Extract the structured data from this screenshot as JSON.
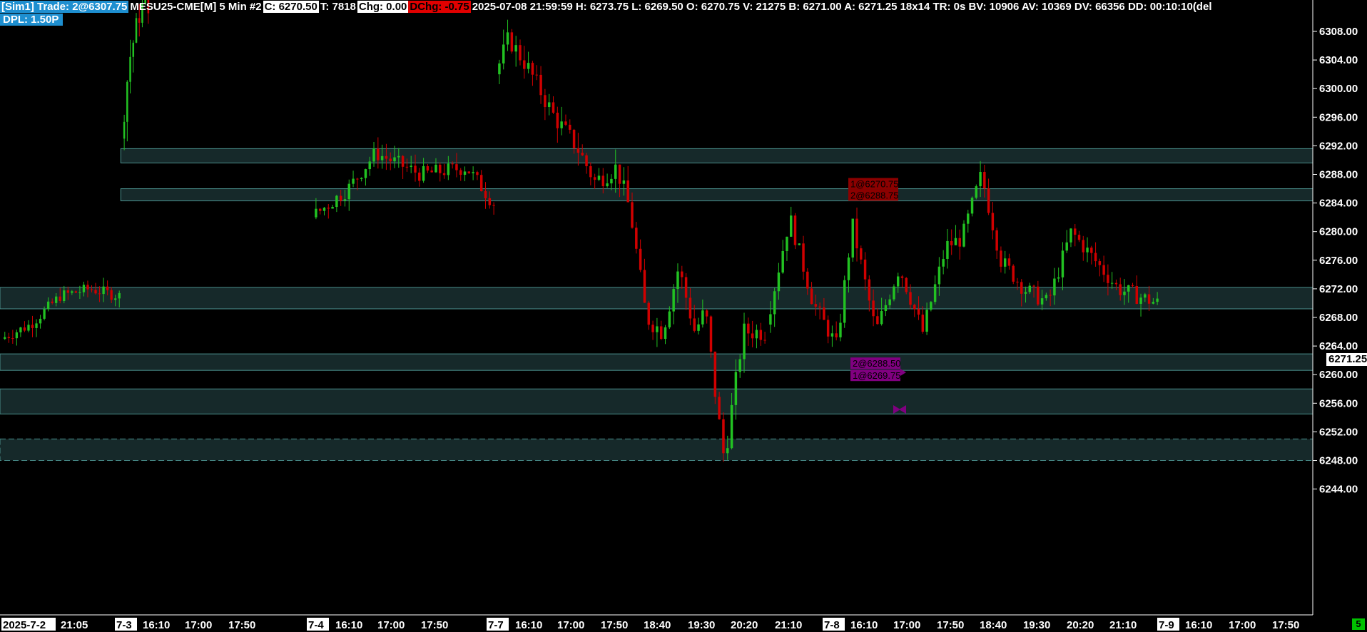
{
  "header": {
    "sim": "[Sim1]  Trade: 2@6307.75",
    "symbol": "MESU25-CME[M]  5 Min  #2",
    "close": "C: 6270.50",
    "trades": "T: 7818",
    "chg": "Chg: 0.00",
    "dchg": "DChg: -0.75",
    "info": "2025-07-08 21:59:59 H: 6273.75 L: 6269.50 O: 6270.75 V: 21275 B: 6271.00 A: 6271.25 18x14 TR: 0s BV: 10906 AV: 10369 DV: 66356 DD: 00:10:10(del",
    "dpl": "DPL: 1.50P"
  },
  "current_price_label": "6271.25",
  "corner_badge": "5",
  "colors": {
    "up": "#22c222",
    "down": "#d00000",
    "zone_fill": "#16292a",
    "zone_border": "#4a8f8c",
    "order_sell": "#8b0000",
    "order_buy": "#800080"
  },
  "chart_data": {
    "type": "candlestick",
    "timeframe": "5 Min",
    "y_ticks": [
      6308.0,
      6304.0,
      6300.0,
      6296.0,
      6292.0,
      6288.0,
      6284.0,
      6280.0,
      6276.0,
      6272.0,
      6268.0,
      6264.0,
      6260.0,
      6256.0,
      6252.0,
      6248.0,
      6244.0
    ],
    "ylim": [
      6242.0,
      6311.0
    ],
    "x_labels": [
      {
        "label": "2025-7-2",
        "boxed": true
      },
      {
        "label": "21:05",
        "boxed": false
      },
      {
        "label": "7-3",
        "boxed": true
      },
      {
        "label": "16:10",
        "boxed": false
      },
      {
        "label": "17:00",
        "boxed": false
      },
      {
        "label": "17:50",
        "boxed": false
      },
      {
        "label": "7-4",
        "boxed": true
      },
      {
        "label": "16:10",
        "boxed": false
      },
      {
        "label": "17:00",
        "boxed": false
      },
      {
        "label": "17:50",
        "boxed": false
      },
      {
        "label": "7-7",
        "boxed": true
      },
      {
        "label": "16:10",
        "boxed": false
      },
      {
        "label": "17:00",
        "boxed": false
      },
      {
        "label": "17:50",
        "boxed": false
      },
      {
        "label": "18:40",
        "boxed": false
      },
      {
        "label": "19:30",
        "boxed": false
      },
      {
        "label": "20:20",
        "boxed": false
      },
      {
        "label": "21:10",
        "boxed": false
      },
      {
        "label": "7-8",
        "boxed": true
      },
      {
        "label": "16:10",
        "boxed": false
      },
      {
        "label": "17:00",
        "boxed": false
      },
      {
        "label": "17:50",
        "boxed": false
      },
      {
        "label": "18:40",
        "boxed": false
      },
      {
        "label": "19:30",
        "boxed": false
      },
      {
        "label": "20:20",
        "boxed": false
      },
      {
        "label": "21:10",
        "boxed": false
      },
      {
        "label": "7-9",
        "boxed": true
      },
      {
        "label": "16:10",
        "boxed": false
      },
      {
        "label": "17:00",
        "boxed": false
      },
      {
        "label": "17:50",
        "boxed": false
      }
    ],
    "zones": [
      {
        "top": 6291.6,
        "bottom": 6289.6,
        "start": 0.092,
        "dashed": false
      },
      {
        "top": 6286.0,
        "bottom": 6284.3,
        "start": 0.092,
        "dashed": false
      },
      {
        "top": 6272.2,
        "bottom": 6269.2,
        "start": 0.0,
        "dashed": false
      },
      {
        "top": 6262.9,
        "bottom": 6260.6,
        "start": 0.0,
        "dashed": false
      },
      {
        "top": 6258.0,
        "bottom": 6254.5,
        "start": 0.0,
        "dashed": false
      },
      {
        "top": 6251.0,
        "bottom": 6248.0,
        "start": 0.0,
        "dashed": true
      }
    ],
    "order_labels": [
      {
        "text": "1@6270.75",
        "price": 6286.7,
        "side": "sell"
      },
      {
        "text": "2@6288.75",
        "price": 6285.1,
        "side": "sell"
      },
      {
        "text": "2@6288.50",
        "price": 6261.6,
        "side": "buy"
      },
      {
        "text": "1@6269.75",
        "price": 6259.9,
        "side": "buy"
      }
    ],
    "segments": [
      {
        "start": 6266.0,
        "path": [
          [
            0,
            6265
          ],
          [
            0.25,
            6267
          ],
          [
            0.5,
            6271
          ],
          [
            0.75,
            6272
          ],
          [
            1,
            6271
          ]
        ],
        "bars": 30,
        "vol": 1.2
      },
      {
        "start": 6293.0,
        "path": [
          [
            0,
            6293
          ],
          [
            0.3,
            6304
          ],
          [
            0.7,
            6311
          ],
          [
            1,
            6312
          ]
        ],
        "bars": 9,
        "vol": 2.5
      },
      {
        "start": 6284.0,
        "path": [
          [
            0,
            6282
          ],
          [
            0.2,
            6286
          ],
          [
            0.35,
            6291
          ],
          [
            0.6,
            6288
          ],
          [
            0.85,
            6289
          ],
          [
            1,
            6284
          ]
        ],
        "bars": 44,
        "vol": 1.6
      },
      {
        "start": 6302.0,
        "path": [
          [
            0,
            6302
          ],
          [
            0.05,
            6307
          ],
          [
            0.12,
            6303
          ],
          [
            0.22,
            6296
          ],
          [
            0.3,
            6292
          ],
          [
            0.37,
            6287
          ],
          [
            0.45,
            6289
          ],
          [
            0.5,
            6283
          ],
          [
            0.56,
            6268
          ],
          [
            0.62,
            6266
          ],
          [
            0.68,
            6275
          ],
          [
            0.74,
            6266
          ],
          [
            0.78,
            6269
          ],
          [
            0.82,
            6256
          ],
          [
            0.85,
            6248
          ],
          [
            0.88,
            6256
          ],
          [
            0.92,
            6266
          ],
          [
            1,
            6266
          ]
        ],
        "bars": 65,
        "vol": 2.0
      },
      {
        "start": 6266.0,
        "path": [
          [
            0,
            6267
          ],
          [
            0.06,
            6282
          ],
          [
            0.12,
            6270
          ],
          [
            0.18,
            6264
          ],
          [
            0.22,
            6281
          ],
          [
            0.28,
            6266
          ],
          [
            0.34,
            6275
          ],
          [
            0.4,
            6266
          ],
          [
            0.46,
            6278
          ],
          [
            0.5,
            6279
          ],
          [
            0.55,
            6288
          ],
          [
            0.6,
            6276
          ],
          [
            0.66,
            6272
          ],
          [
            0.72,
            6270
          ],
          [
            0.78,
            6280
          ],
          [
            0.84,
            6276
          ],
          [
            0.9,
            6272
          ],
          [
            1,
            6270
          ]
        ],
        "bars": 95,
        "vol": 1.7
      }
    ]
  }
}
